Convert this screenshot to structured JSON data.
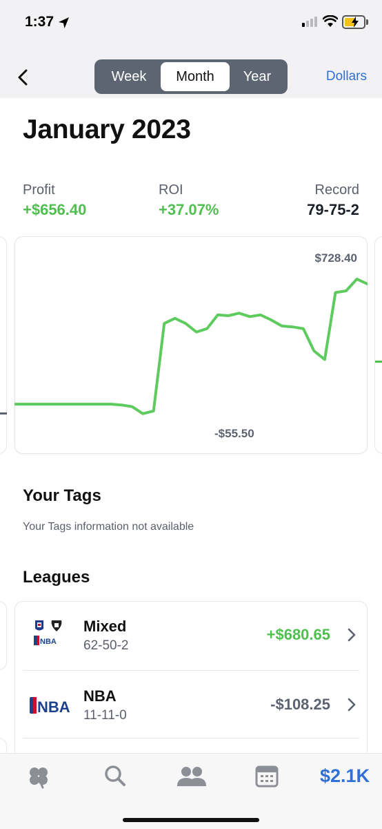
{
  "status_bar": {
    "time": "1:37"
  },
  "header": {
    "back_icon": "chevron-left-icon",
    "segments": [
      "Week",
      "Month",
      "Year"
    ],
    "selected_segment": "Month",
    "unit_toggle": "Dollars"
  },
  "page": {
    "title": "January 2023"
  },
  "stats": {
    "profit": {
      "label": "Profit",
      "value": "+$656.40"
    },
    "roi": {
      "label": "ROI",
      "value": "+37.07%"
    },
    "record": {
      "label": "Record",
      "value": "79-75-2"
    }
  },
  "chart": {
    "max_label": "$728.40",
    "min_label": "-$55.50",
    "line_color": "#5ecb5e"
  },
  "chart_data": {
    "type": "line",
    "series": [
      {
        "values": [
          0,
          0,
          0,
          0,
          0,
          0,
          0,
          0,
          0,
          0,
          -5,
          -15,
          -55.5,
          -40,
          470,
          500,
          470,
          420,
          440,
          520,
          515,
          530,
          510,
          520,
          490,
          455,
          450,
          440,
          310,
          260,
          650,
          660,
          728.4,
          700
        ]
      }
    ]
  },
  "tags": {
    "heading": "Your Tags",
    "empty_text": "Your Tags information not available"
  },
  "leagues": {
    "heading": "Leagues",
    "items": [
      {
        "name": "Mixed",
        "record": "62-50-2",
        "amount": "+$680.65",
        "logo_icon": "mixed-leagues-logo-icon"
      },
      {
        "name": "NBA",
        "record": "11-11-0",
        "amount": "-$108.25",
        "logo_icon": "nba-logo-icon"
      }
    ]
  },
  "tabbar": {
    "icons": [
      "clover-icon",
      "search-icon",
      "people-icon",
      "calendar-icon"
    ],
    "balance": "$2.1K"
  },
  "colors": {
    "accent_blue": "#2f6fd6",
    "positive_green": "#4fbf4f",
    "segment_bg": "#5d6572"
  }
}
